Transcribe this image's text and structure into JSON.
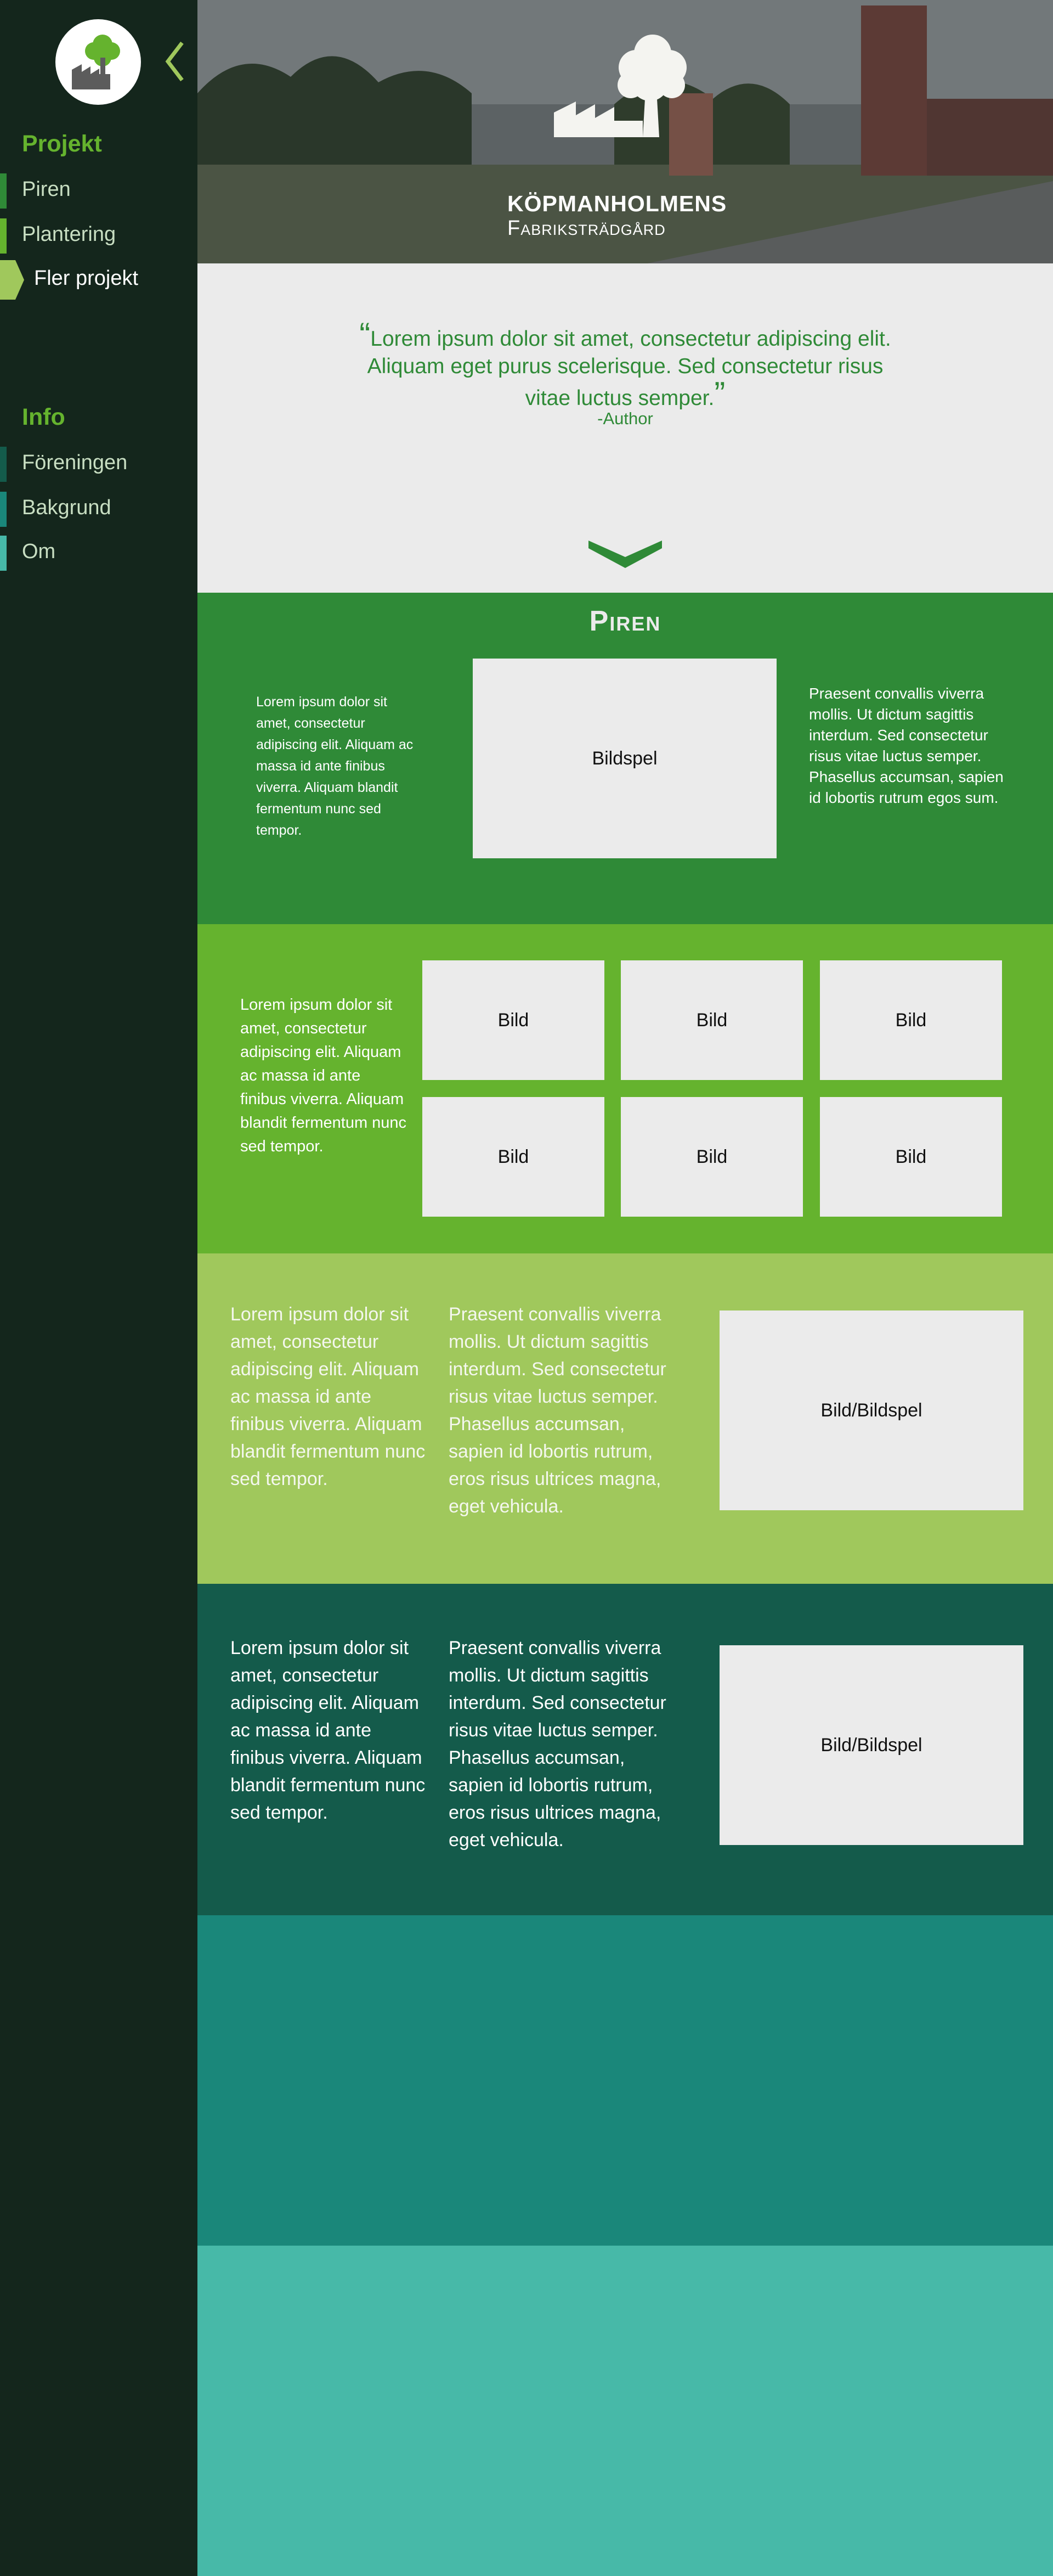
{
  "colors": {
    "sidebar_bg": "#14261c",
    "green_dark": "#2f8a37",
    "green_mid": "#65b32e",
    "green_light": "#a0c85c",
    "teal_dark": "#145b4b",
    "teal_mid": "#1a877a",
    "teal_light": "#47b9a8",
    "placeholder": "#ebebeb"
  },
  "sidebar": {
    "logo": "factory-tree-logo",
    "collapse_icon": "chevron-left-icon",
    "projekt": {
      "heading": "Projekt",
      "items": [
        {
          "label": "Piren",
          "color": "#2f8a37"
        },
        {
          "label": "Plantering",
          "color": "#65b32e"
        },
        {
          "label": "Fler projekt",
          "color": "#a0c85c",
          "active": true
        }
      ]
    },
    "info": {
      "heading": "Info",
      "items": [
        {
          "label": "Föreningen",
          "color": "#145b4b"
        },
        {
          "label": "Bakgrund",
          "color": "#1a877a"
        },
        {
          "label": "Om",
          "color": "#47b9a8"
        }
      ]
    }
  },
  "hero": {
    "brand_line1": "Köpmanholmens",
    "brand_line2": "Fabriksträdgård"
  },
  "quote": {
    "text": "Lorem ipsum dolor sit amet, consectetur adipiscing elit. Aliquam eget purus scelerisque. Sed consectetur risus vitae luctus semper.",
    "author": "-Author",
    "scroll_icon": "chevron-down-icon"
  },
  "piren": {
    "title": "Piren",
    "left_text": "Lorem ipsum dolor sit amet, consectetur adipiscing elit. Aliquam ac massa id ante finibus viverra. Aliquam blandit fermentum nunc sed tempor.",
    "slideshow_label": "Bildspel",
    "right_text": "Praesent convallis viverra mollis. Ut dictum sagittis interdum. Sed consectetur risus vitae luctus semper. Phasellus accumsan, sapien id lobortis rutrum egos sum."
  },
  "gallery": {
    "text": "Lorem ipsum dolor sit amet, consectetur adipiscing elit. Aliquam ac massa id ante finibus viverra. Aliquam blandit fermentum nunc sed tempor.",
    "images": [
      "Bild",
      "Bild",
      "Bild",
      "Bild",
      "Bild",
      "Bild"
    ]
  },
  "section3": {
    "left_text": "Lorem ipsum dolor sit amet, consectetur adipiscing elit. Aliquam ac massa id ante finibus viverra. Aliquam blandit fermentum nunc sed tempor.",
    "mid_text": "Praesent convallis viverra mollis. Ut dictum sagittis interdum. Sed consectetur risus vitae luctus semper. Phasellus accumsan, sapien id lobortis rutrum, eros risus ultrices magna, eget vehicula.",
    "media_label": "Bild/Bildspel"
  },
  "section4": {
    "left_text": "Lorem ipsum dolor sit amet, consectetur adipiscing elit. Aliquam ac massa id ante finibus viverra. Aliquam blandit fermentum nunc sed tempor.",
    "mid_text": "Praesent convallis viverra mollis. Ut dictum sagittis interdum. Sed consectetur risus vitae luctus semper. Phasellus accumsan, sapien id lobortis rutrum, eros risus ultrices magna, eget vehicula.",
    "media_label": "Bild/Bildspel"
  }
}
